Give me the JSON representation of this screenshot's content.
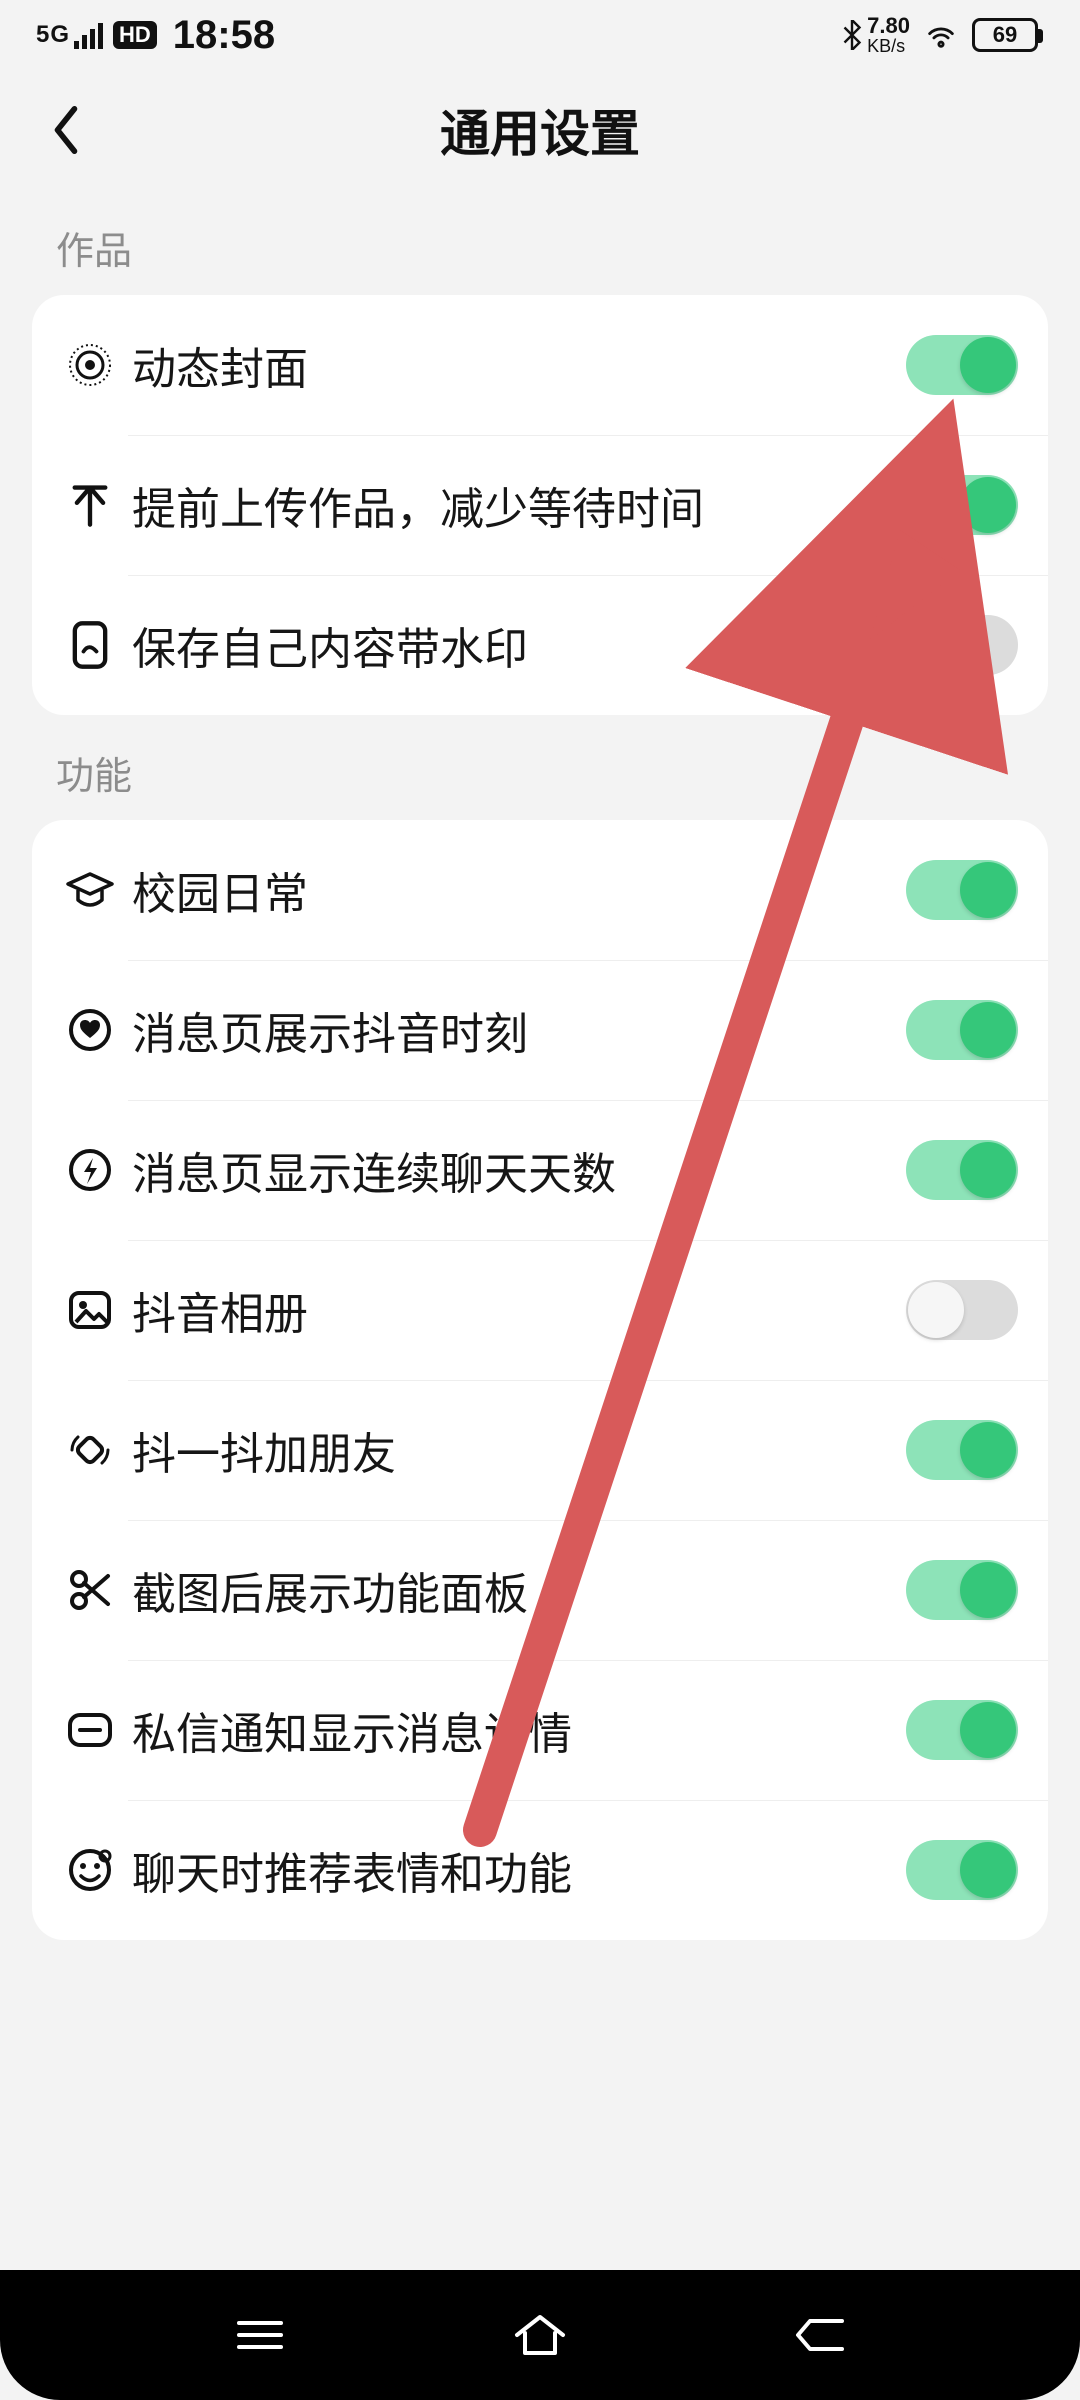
{
  "status": {
    "network_label": "5G",
    "hd_badge": "HD",
    "time": "18:58",
    "bt_rate_value": "7.80",
    "bt_rate_unit": "KB/s",
    "battery_pct": "69"
  },
  "header": {
    "title": "通用设置"
  },
  "sections": [
    {
      "label": "作品",
      "items": [
        {
          "icon": "target-icon",
          "label": "动态封面",
          "toggle": true
        },
        {
          "icon": "upload-arrow-icon",
          "label": "提前上传作品，减少等待时间",
          "toggle": true
        },
        {
          "icon": "photo-save-icon",
          "label": "保存自己内容带水印",
          "toggle": false
        }
      ]
    },
    {
      "label": "功能",
      "items": [
        {
          "icon": "graduation-cap-icon",
          "label": "校园日常",
          "toggle": true
        },
        {
          "icon": "heart-circle-icon",
          "label": "消息页展示抖音时刻",
          "toggle": true
        },
        {
          "icon": "bolt-circle-icon",
          "label": "消息页显示连续聊天天数",
          "toggle": true
        },
        {
          "icon": "image-icon",
          "label": "抖音相册",
          "toggle": false
        },
        {
          "icon": "rotate-icon",
          "label": "抖一抖加朋友",
          "toggle": true
        },
        {
          "icon": "scissors-icon",
          "label": "截图后展示功能面板",
          "toggle": true
        },
        {
          "icon": "message-detail-icon",
          "label": "私信通知显示消息详情",
          "toggle": true
        },
        {
          "icon": "emoji-icon",
          "label": "聊天时推荐表情和功能",
          "toggle": true
        }
      ]
    }
  ],
  "colors": {
    "toggle_on_track": "#8de3b8",
    "toggle_on_knob": "#35c77a",
    "toggle_off_track": "#dcdcdc",
    "arrow": "#d85a5a"
  }
}
